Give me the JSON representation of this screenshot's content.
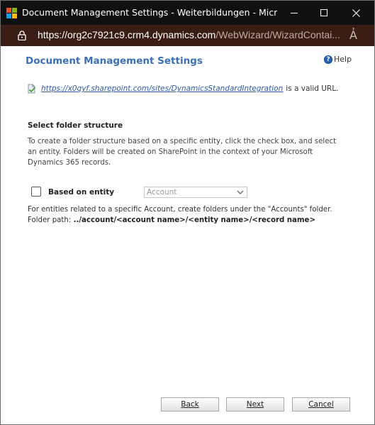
{
  "window": {
    "title": "Document Management Settings - Weiterbildungen - Microsoft E...",
    "minimize_icon": "minimize-icon",
    "maximize_icon": "maximize-icon",
    "close_icon": "close-icon"
  },
  "address_bar": {
    "url_domain": "https://org2c7921c9.crm4.dynamics.com",
    "url_rest": "/WebWizard/WizardContai...",
    "lock_icon": "lock-icon",
    "reader_icon": "read-aloud-icon",
    "reader_glyph": "A҆"
  },
  "page": {
    "title": "Document Management Settings",
    "help_label": "Help",
    "help_glyph": "?",
    "sharepoint_url": "https://x0qyf.sharepoint.com/sites/DynamicsStandardIntegration",
    "valid_suffix": "is a valid URL.",
    "section_heading": "Select folder structure",
    "section_description": "To create a folder structure based on a specific entity, click the check box, and select an entity. Folders will be created on SharePoint in the context of your Microsoft Dynamics 365 records.",
    "checkbox_label": "Based on entity",
    "checkbox_checked": false,
    "entity_select_value": "Account",
    "note_line1": "For entities related to a specific Account, create folders under the \"Accounts\" folder.",
    "folder_path_label": "Folder path:",
    "folder_path_value": "../account/<account name>/<entity name>/<record name>"
  },
  "footer": {
    "back_label": "Back",
    "next_label": "Next",
    "cancel_label": "Cancel"
  },
  "colors": {
    "title_bar": "#101010",
    "address_bar": "#3a1e15",
    "heading_blue": "#3b6fb8",
    "link_blue": "#2f5aa8"
  }
}
